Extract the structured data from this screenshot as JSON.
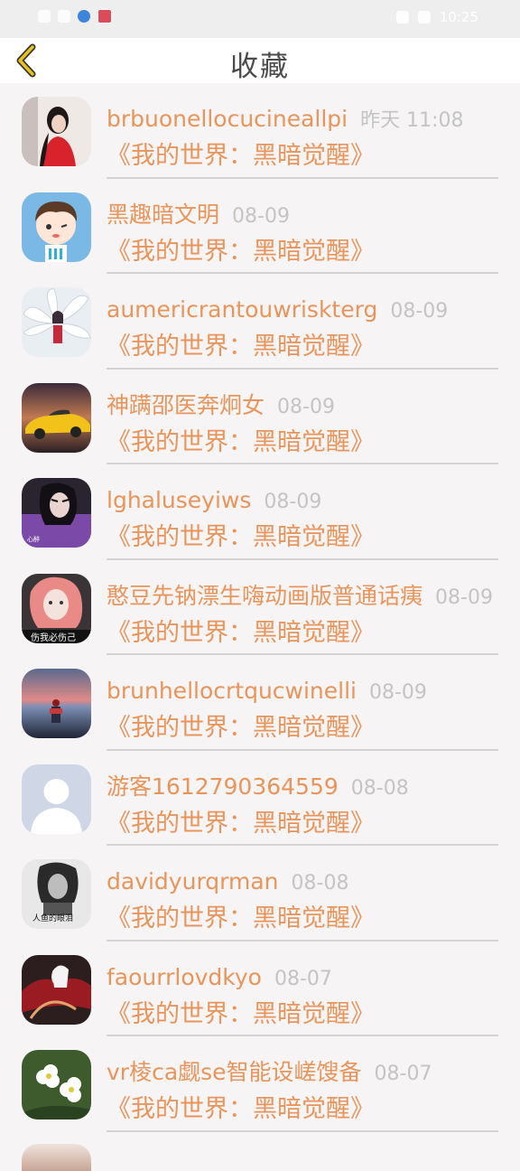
{
  "status_bar": {
    "carrier": "▪▪ ᯤ",
    "time": "10:25"
  },
  "header": {
    "title": "收藏"
  },
  "items": [
    {
      "name": "brbuonellocucineallpi",
      "time": "昨天 11:08",
      "book": "《我的世界：黑暗觉醒》",
      "avatar": "woman-red-dress"
    },
    {
      "name": "黑趣暗文明",
      "time": "08-09",
      "book": "《我的世界：黑暗觉醒》",
      "avatar": "cartoon-boy"
    },
    {
      "name": "aumericrantouwriskterg",
      "time": "08-09",
      "book": "《我的世界：黑暗觉醒》",
      "avatar": "nine-tail-fox-girl"
    },
    {
      "name": "神蹒邵医奔炯女",
      "time": "08-09",
      "book": "《我的世界：黑暗觉醒》",
      "avatar": "yellow-sports-car"
    },
    {
      "name": "lghaluseyiws",
      "time": "08-09",
      "book": "《我的世界：黑暗觉醒》",
      "avatar": "woman-purple"
    },
    {
      "name": "憨豆先钠漂生嗨动画版普通话痍",
      "time": "08-09",
      "book": "《我的世界：黑暗觉醒》",
      "avatar": "girl-pink-hair"
    },
    {
      "name": "brunhellocrtqucwinelli",
      "time": "08-09",
      "book": "《我的世界：黑暗觉醒》",
      "avatar": "sunset-sea"
    },
    {
      "name": "游客1612790364559",
      "time": "08-08",
      "book": "《我的世界：黑暗觉醒》",
      "avatar": "default-user"
    },
    {
      "name": "davidyurqrman",
      "time": "08-08",
      "book": "《我的世界：黑暗觉醒》",
      "avatar": "bw-portrait"
    },
    {
      "name": "faourrlovdkyo",
      "time": "08-07",
      "book": "《我的世界：黑暗觉醒》",
      "avatar": "red-warrior"
    },
    {
      "name": "vr棱ca觑se智能设嵯馊备",
      "time": "08-07",
      "book": "《我的世界：黑暗觉醒》",
      "avatar": "white-flowers"
    }
  ],
  "colors": {
    "accent": "#e8955b",
    "muted": "#c4c4c4",
    "title": "#4b4b4b",
    "back_arrow": "#e6c21e"
  }
}
